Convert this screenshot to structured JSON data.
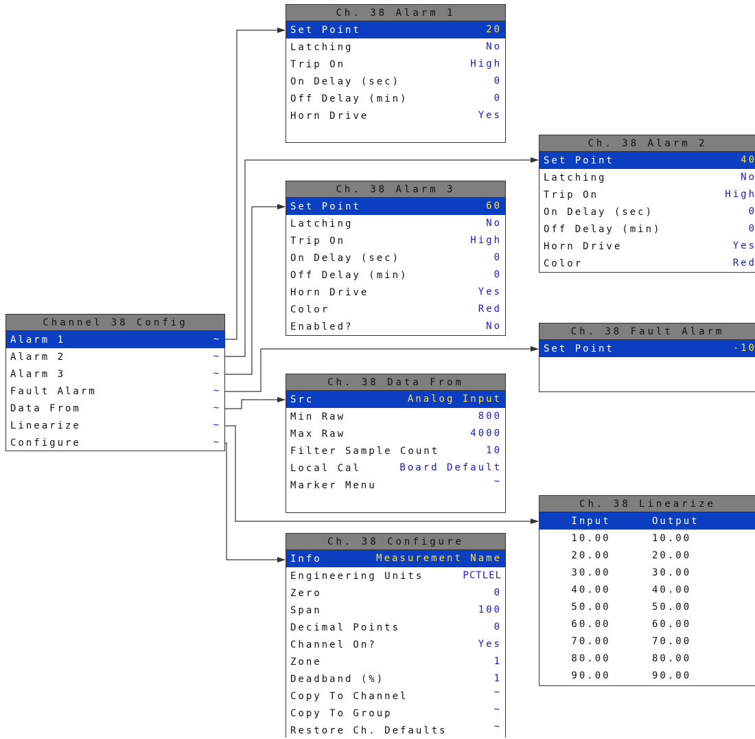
{
  "main_menu": {
    "title": "Channel 38 Config",
    "items": [
      {
        "label": "Alarm 1",
        "value": "~"
      },
      {
        "label": "Alarm 2",
        "value": "~"
      },
      {
        "label": "Alarm 3",
        "value": "~"
      },
      {
        "label": "Fault Alarm",
        "value": "~"
      },
      {
        "label": "Data From",
        "value": "~"
      },
      {
        "label": "Linearize",
        "value": "~"
      },
      {
        "label": "Configure",
        "value": "~"
      }
    ]
  },
  "alarm1": {
    "title": "Ch. 38 Alarm 1",
    "rows": [
      {
        "label": "Set Point",
        "value": "20"
      },
      {
        "label": "Latching",
        "value": "No"
      },
      {
        "label": "Trip On",
        "value": "High"
      },
      {
        "label": "On Delay (sec)",
        "value": "0"
      },
      {
        "label": "Off Delay (min)",
        "value": "0"
      },
      {
        "label": "Horn Drive",
        "value": "Yes"
      }
    ]
  },
  "alarm2": {
    "title": "Ch. 38 Alarm 2",
    "rows": [
      {
        "label": "Set Point",
        "value": "40"
      },
      {
        "label": "Latching",
        "value": "No"
      },
      {
        "label": "Trip On",
        "value": "High"
      },
      {
        "label": "On Delay (sec)",
        "value": "0"
      },
      {
        "label": "Off Delay (min)",
        "value": "0"
      },
      {
        "label": "Horn Drive",
        "value": "Yes"
      },
      {
        "label": "Color",
        "value": "Red"
      }
    ]
  },
  "alarm3": {
    "title": "Ch. 38 Alarm 3",
    "rows": [
      {
        "label": "Set Point",
        "value": "60"
      },
      {
        "label": "Latching",
        "value": "No"
      },
      {
        "label": "Trip On",
        "value": "High"
      },
      {
        "label": "On Delay (sec)",
        "value": "0"
      },
      {
        "label": "Off Delay (min)",
        "value": "0"
      },
      {
        "label": "Horn Drive",
        "value": "Yes"
      },
      {
        "label": "Color",
        "value": "Red"
      },
      {
        "label": "Enabled?",
        "value": "No"
      }
    ]
  },
  "fault_alarm": {
    "title": "Ch. 38 Fault Alarm",
    "rows": [
      {
        "label": "Set Point",
        "value": "-10"
      }
    ]
  },
  "data_from": {
    "title": "Ch. 38 Data From",
    "rows": [
      {
        "label": "Src",
        "value": "Analog Input"
      },
      {
        "label": "Min Raw",
        "value": "800"
      },
      {
        "label": "Max Raw",
        "value": "4000"
      },
      {
        "label": "Filter Sample Count",
        "value": "10"
      },
      {
        "label": "Local Cal",
        "value": "Board Default"
      },
      {
        "label": "Marker Menu",
        "value": "~"
      }
    ]
  },
  "linearize": {
    "title": "Ch. 38 Linearize",
    "header": {
      "input": "Input",
      "output": "Output"
    },
    "rows": [
      {
        "input": "10.00",
        "output": "10.00"
      },
      {
        "input": "20.00",
        "output": "20.00"
      },
      {
        "input": "30.00",
        "output": "30.00"
      },
      {
        "input": "40.00",
        "output": "40.00"
      },
      {
        "input": "50.00",
        "output": "50.00"
      },
      {
        "input": "60.00",
        "output": "60.00"
      },
      {
        "input": "70.00",
        "output": "70.00"
      },
      {
        "input": "80.00",
        "output": "80.00"
      },
      {
        "input": "90.00",
        "output": "90.00"
      }
    ]
  },
  "configure": {
    "title": "Ch. 38 Configure",
    "rows": [
      {
        "label": "Info",
        "value": "Measurement Name"
      },
      {
        "label": "Engineering Units",
        "value": "PCTLEL"
      },
      {
        "label": "Zero",
        "value": "0"
      },
      {
        "label": "Span",
        "value": "100"
      },
      {
        "label": "Decimal Points",
        "value": "0"
      },
      {
        "label": "Channel On?",
        "value": "Yes"
      },
      {
        "label": "Zone",
        "value": "1"
      },
      {
        "label": "Deadband (%)",
        "value": "1"
      },
      {
        "label": "Copy To Channel",
        "value": "~"
      },
      {
        "label": "Copy To Group",
        "value": "~"
      },
      {
        "label": "Restore Ch. Defaults",
        "value": "~"
      }
    ]
  },
  "colors": {
    "title_bar": "#7f7f7f",
    "selection": "#0b3ec1",
    "value_text": "#1818d8",
    "selected_value_text": "#ffe03a"
  }
}
